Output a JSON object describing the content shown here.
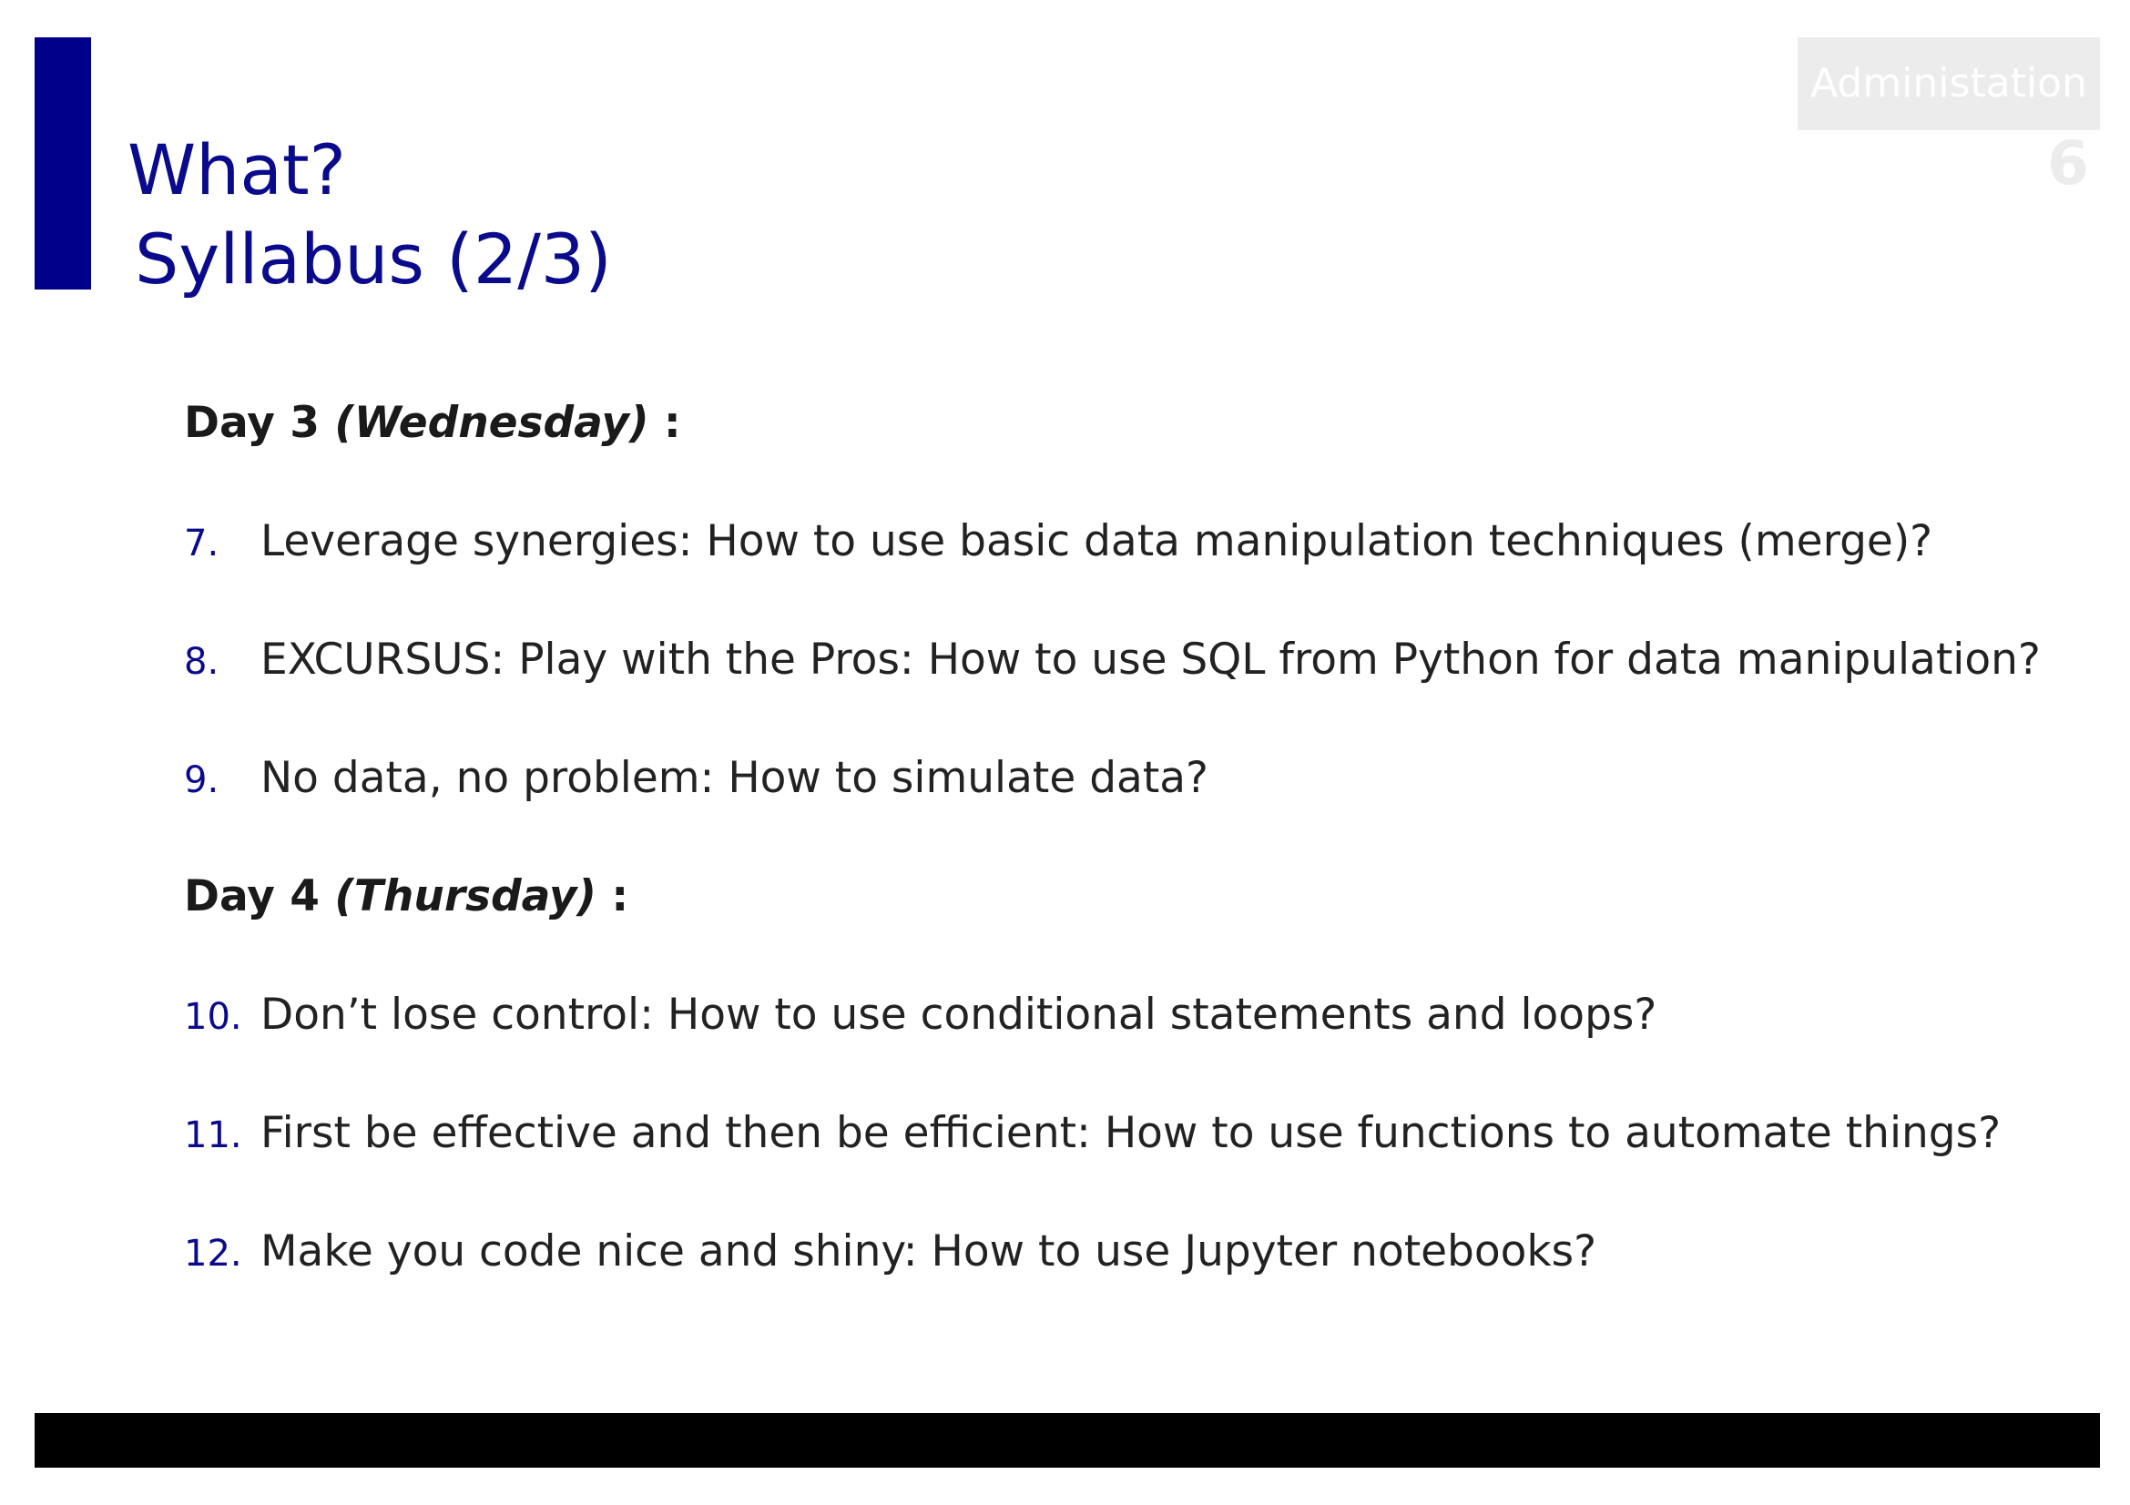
{
  "header": {
    "title_line1": "What?",
    "title_line2": "Syllabus (2/3)",
    "section_tag": "Administation",
    "page_number": "6"
  },
  "days": [
    {
      "label": "Day 3",
      "paren": "(Wednesday)",
      "suffix": " :",
      "items": [
        {
          "num": "7.",
          "text": "Leverage synergies: How to use basic data manipulation techniques (merge)?"
        },
        {
          "num": "8.",
          "text": "EXCURSUS: Play with the Pros: How to use SQL from Python for data manipulation?"
        },
        {
          "num": "9.",
          "text": "No data, no problem: How to simulate data?"
        }
      ]
    },
    {
      "label": "Day 4",
      "paren": "(Thursday)",
      "suffix": " :",
      "items": [
        {
          "num": "10.",
          "text": "Don’t lose control: How to use conditional statements and loops?"
        },
        {
          "num": "11.",
          "text": "First be effective and then be efficient: How to use functions to automate things?"
        },
        {
          "num": "12.",
          "text": "Make you code nice and shiny: How to use Jupyter notebooks?"
        }
      ]
    }
  ],
  "colors": {
    "accent": "#00008b",
    "title": "#0a0a8c",
    "footer": "#000000",
    "tag_bg": "#ececec"
  }
}
